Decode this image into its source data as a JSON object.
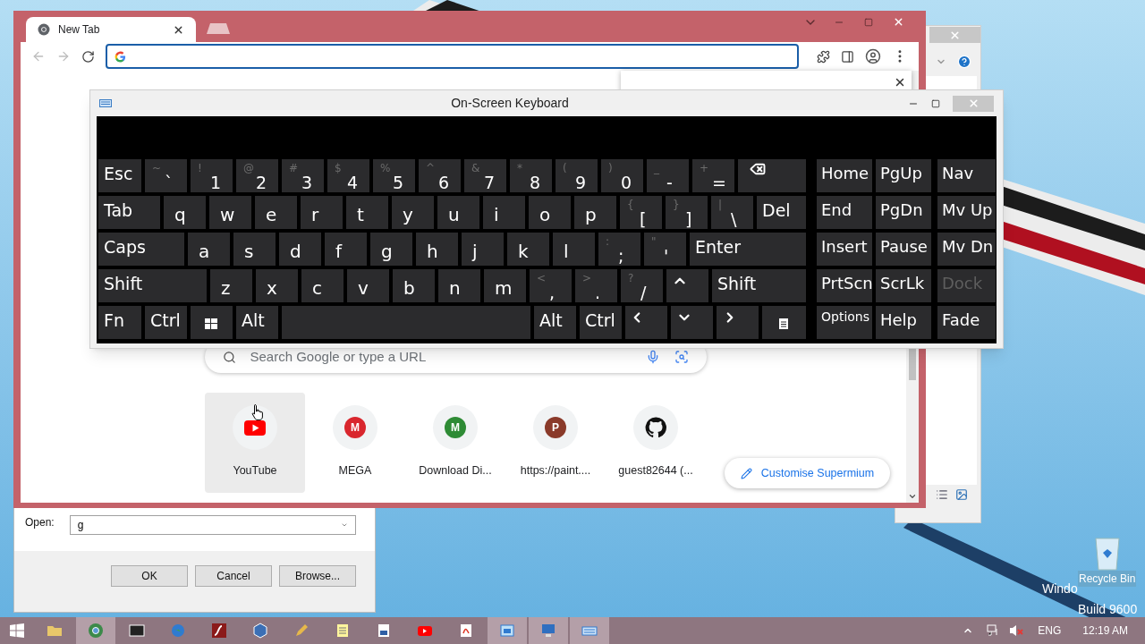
{
  "desktop": {
    "os_label": "Windo",
    "recycle_bin": "Recycle Bin",
    "build": "Build 9600"
  },
  "run_dialog": {
    "open_label": "Open:",
    "value": "g",
    "buttons": [
      "OK",
      "Cancel",
      "Browse..."
    ]
  },
  "browser": {
    "tab": {
      "title": "New Tab"
    },
    "search": {
      "placeholder": "Search Google or type a URL"
    },
    "shortcuts": [
      {
        "title": "YouTube",
        "kind": "play",
        "hovered": true
      },
      {
        "title": "MEGA",
        "kind": "letter",
        "letter": "M",
        "color": "#d9272e",
        "hovered": false
      },
      {
        "title": "Download Di...",
        "kind": "letter",
        "letter": "M",
        "color": "#2e8b35",
        "hovered": false
      },
      {
        "title": "https://paint....",
        "kind": "letter",
        "letter": "P",
        "color": "#8a3a2a",
        "hovered": false
      },
      {
        "title": "guest82644 (...",
        "kind": "octocat",
        "hovered": false
      }
    ],
    "customise": "Customise Supermium"
  },
  "keyboard": {
    "title": "On-Screen Keyboard",
    "rows": [
      [
        {
          "kind": "text",
          "label": "Esc"
        },
        {
          "kind": "char",
          "shift": "~",
          "label": "`"
        },
        {
          "kind": "char",
          "shift": "!",
          "label": "1"
        },
        {
          "kind": "char",
          "shift": "@",
          "label": "2"
        },
        {
          "kind": "char",
          "shift": "#",
          "label": "3"
        },
        {
          "kind": "char",
          "shift": "$",
          "label": "4"
        },
        {
          "kind": "char",
          "shift": "%",
          "label": "5"
        },
        {
          "kind": "char",
          "shift": "^",
          "label": "6"
        },
        {
          "kind": "char",
          "shift": "&",
          "label": "7"
        },
        {
          "kind": "char",
          "shift": "*",
          "label": "8"
        },
        {
          "kind": "char",
          "shift": "(",
          "label": "9"
        },
        {
          "kind": "char",
          "shift": ")",
          "label": "0"
        },
        {
          "kind": "char",
          "shift": "_",
          "label": "-"
        },
        {
          "kind": "char",
          "shift": "+",
          "label": "="
        },
        {
          "kind": "backspace"
        }
      ],
      [
        {
          "kind": "text",
          "label": "Tab"
        },
        {
          "kind": "letter",
          "label": "q"
        },
        {
          "kind": "letter",
          "label": "w"
        },
        {
          "kind": "letter",
          "label": "e"
        },
        {
          "kind": "letter",
          "label": "r"
        },
        {
          "kind": "letter",
          "label": "t"
        },
        {
          "kind": "letter",
          "label": "y"
        },
        {
          "kind": "letter",
          "label": "u"
        },
        {
          "kind": "letter",
          "label": "i"
        },
        {
          "kind": "letter",
          "label": "o"
        },
        {
          "kind": "letter",
          "label": "p"
        },
        {
          "kind": "char",
          "shift": "{",
          "label": "["
        },
        {
          "kind": "char",
          "shift": "}",
          "label": "]"
        },
        {
          "kind": "char",
          "shift": "|",
          "label": "\\"
        },
        {
          "kind": "text",
          "label": "Del"
        }
      ],
      [
        {
          "kind": "text",
          "label": "Caps"
        },
        {
          "kind": "letter",
          "label": "a"
        },
        {
          "kind": "letter",
          "label": "s"
        },
        {
          "kind": "letter",
          "label": "d"
        },
        {
          "kind": "letter",
          "label": "f"
        },
        {
          "kind": "letter",
          "label": "g"
        },
        {
          "kind": "letter",
          "label": "h"
        },
        {
          "kind": "letter",
          "label": "j"
        },
        {
          "kind": "letter",
          "label": "k"
        },
        {
          "kind": "letter",
          "label": "l"
        },
        {
          "kind": "char",
          "shift": ":",
          "label": ";"
        },
        {
          "kind": "char",
          "shift": "\"",
          "label": "'"
        },
        {
          "kind": "text",
          "label": "Enter"
        }
      ],
      [
        {
          "kind": "text",
          "label": "Shift"
        },
        {
          "kind": "letter",
          "label": "z"
        },
        {
          "kind": "letter",
          "label": "x"
        },
        {
          "kind": "letter",
          "label": "c"
        },
        {
          "kind": "letter",
          "label": "v"
        },
        {
          "kind": "letter",
          "label": "b"
        },
        {
          "kind": "letter",
          "label": "n"
        },
        {
          "kind": "letter",
          "label": "m"
        },
        {
          "kind": "char",
          "shift": "<",
          "label": ","
        },
        {
          "kind": "char",
          "shift": ">",
          "label": "."
        },
        {
          "kind": "char",
          "shift": "?",
          "label": "/"
        },
        {
          "kind": "up"
        },
        {
          "kind": "text",
          "label": "Shift"
        }
      ],
      [
        {
          "kind": "text",
          "label": "Fn"
        },
        {
          "kind": "text",
          "label": "Ctrl"
        },
        {
          "kind": "windows"
        },
        {
          "kind": "text",
          "label": "Alt"
        },
        {
          "kind": "space"
        },
        {
          "kind": "text",
          "label": "Alt"
        },
        {
          "kind": "text",
          "label": "Ctrl"
        },
        {
          "kind": "left"
        },
        {
          "kind": "down"
        },
        {
          "kind": "right"
        },
        {
          "kind": "menu"
        }
      ]
    ],
    "nav": [
      [
        {
          "label": "Home",
          "disabled": false
        },
        {
          "label": "PgUp",
          "disabled": false
        },
        {
          "label": "Nav",
          "disabled": false
        }
      ],
      [
        {
          "label": "End",
          "disabled": false
        },
        {
          "label": "PgDn",
          "disabled": false
        },
        {
          "label": "Mv Up",
          "disabled": false
        }
      ],
      [
        {
          "label": "Insert",
          "disabled": false
        },
        {
          "label": "Pause",
          "disabled": false
        },
        {
          "label": "Mv Dn",
          "disabled": false
        }
      ],
      [
        {
          "label": "PrtScn",
          "disabled": false
        },
        {
          "label": "ScrLk",
          "disabled": false
        },
        {
          "label": "Dock",
          "disabled": true
        }
      ],
      [
        {
          "label": "Options",
          "disabled": false
        },
        {
          "label": "Help",
          "disabled": false
        },
        {
          "label": "Fade",
          "disabled": false
        }
      ]
    ]
  },
  "taskbar": {
    "items": [
      {
        "kind": "folder",
        "selected": false
      },
      {
        "kind": "browser",
        "selected": true
      },
      {
        "kind": "archive",
        "selected": false
      },
      {
        "kind": "globe",
        "selected": false
      },
      {
        "kind": "flash",
        "selected": false
      },
      {
        "kind": "cube",
        "selected": false
      },
      {
        "kind": "pencil",
        "selected": false
      },
      {
        "kind": "notepad",
        "selected": false
      },
      {
        "kind": "document",
        "selected": false
      },
      {
        "kind": "play",
        "selected": false
      },
      {
        "kind": "pdf",
        "selected": false
      },
      {
        "kind": "window",
        "selected": true
      },
      {
        "kind": "computer",
        "selected": true
      },
      {
        "kind": "keyboard",
        "selected": true
      }
    ],
    "language": "ENG",
    "time": "12:19 AM"
  }
}
